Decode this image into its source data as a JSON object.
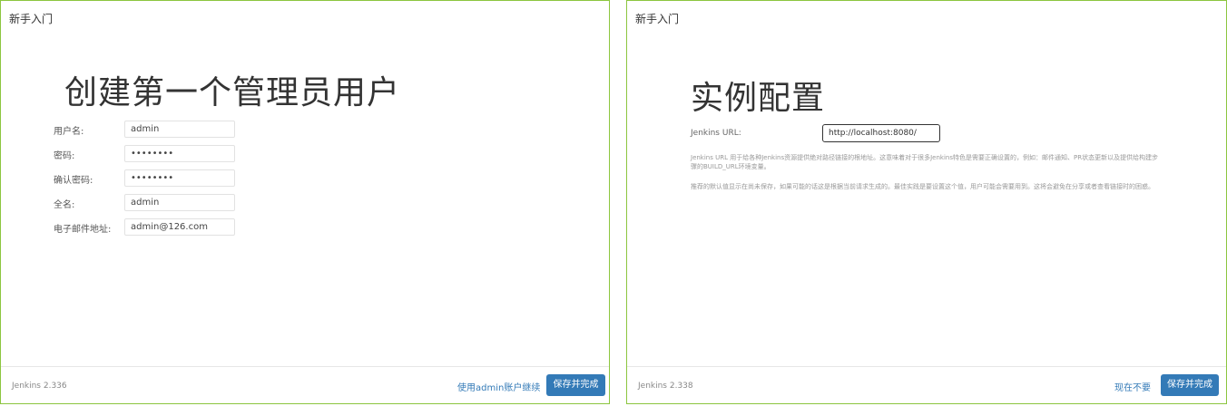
{
  "left_panel": {
    "title": "新手入门",
    "heading": "创建第一个管理员用户",
    "fields": [
      {
        "label": "用户名:",
        "value": "admin"
      },
      {
        "label": "密码:",
        "value": "••••••••"
      },
      {
        "label": "确认密码:",
        "value": "••••••••"
      },
      {
        "label": "全名:",
        "value": "admin"
      },
      {
        "label": "电子邮件地址:",
        "value": "admin@126.com"
      }
    ],
    "footer": {
      "version": "Jenkins 2.336",
      "secondary_button": "使用admin账户继续",
      "primary_button": "保存并完成"
    }
  },
  "right_panel": {
    "title": "新手入门",
    "heading": "实例配置",
    "url_label": "Jenkins URL:",
    "url_value": "http://localhost:8080/",
    "help_line_1": "Jenkins URL 用于给各种Jenkins资源提供绝对路径链接的根地址。这意味着对于很多Jenkins特色是需要正确设置的，例如：邮件通知、PR状态更新以及提供给构建步骤的BUILD_URL环境变量。",
    "help_line_2": "推荐的默认值显示在尚未保存，如果可能的话这是根据当前请求生成的。最佳实践是要设置这个值，用户可能会需要用到。这将会避免在分享或者查看链接时的困惑。",
    "footer": {
      "version": "Jenkins 2.338",
      "secondary_button": "现在不要",
      "primary_button": "保存并完成"
    }
  }
}
